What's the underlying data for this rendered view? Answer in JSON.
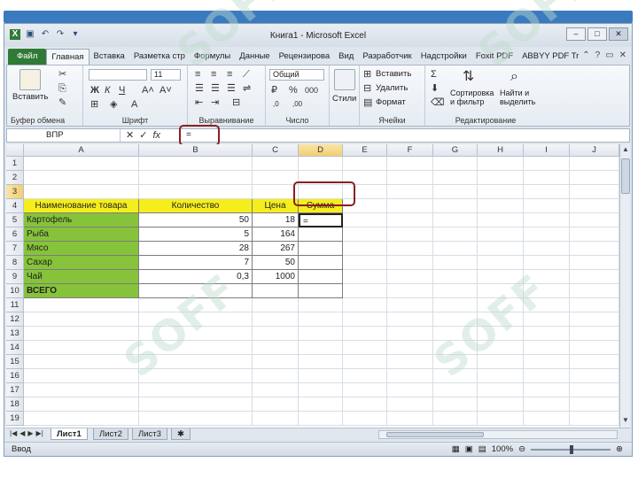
{
  "window": {
    "title": "Книга1 - Microsoft Excel"
  },
  "tabs": [
    "Файл",
    "Главная",
    "Вставка",
    "Разметка стр",
    "Формулы",
    "Данные",
    "Рецензирова",
    "Вид",
    "Разработчик",
    "Надстройки",
    "Foxit PDF",
    "ABBYY PDF Tr"
  ],
  "ribbon": {
    "paste_label": "Вставить",
    "font_name": "",
    "font_size": "11",
    "number_format": "Общий",
    "styles_label": "Стили",
    "insert_label": "Вставить",
    "delete_label": "Удалить",
    "format_label": "Формат",
    "sort_label": "Сортировка\nи фильтр",
    "find_label": "Найти и\nвыделить",
    "groups": {
      "clipboard": "Буфер обмена",
      "font": "Шрифт",
      "alignment": "Выравнивание",
      "number": "Число",
      "cells": "Ячейки",
      "editing": "Редактирование"
    }
  },
  "formula_bar": {
    "name_box": "ВПР",
    "content": "="
  },
  "columns": [
    "A",
    "B",
    "C",
    "D",
    "E",
    "F",
    "G",
    "H",
    "I",
    "J"
  ],
  "rows": [
    "1",
    "2",
    "3",
    "4",
    "5",
    "6",
    "7",
    "8",
    "9",
    "10",
    "11",
    "12",
    "13",
    "14",
    "15",
    "16",
    "17",
    "18",
    "19"
  ],
  "headers": {
    "a2": "Наименование товара",
    "b2": "Количество",
    "c2": "Цена",
    "d2": "Сумма"
  },
  "items": [
    {
      "name": "Картофель",
      "qty": "50",
      "price": "18"
    },
    {
      "name": "Рыба",
      "qty": "5",
      "price": "164"
    },
    {
      "name": "Мясо",
      "qty": "28",
      "price": "267"
    },
    {
      "name": "Сахар",
      "qty": "7",
      "price": "50"
    },
    {
      "name": "Чай",
      "qty": "0,3",
      "price": "1000"
    }
  ],
  "total_label": "ВСЕГО",
  "active_cell_value": "=",
  "sheets": [
    "Лист1",
    "Лист2",
    "Лист3"
  ],
  "status": {
    "mode": "Ввод",
    "zoom": "100%"
  },
  "watermark": "SOFF",
  "colors": {
    "header_yellow": "#f5ee1c",
    "name_green": "#86c33a",
    "file_tab": "#2f7a35",
    "highlight_circle": "#8a1f22"
  }
}
